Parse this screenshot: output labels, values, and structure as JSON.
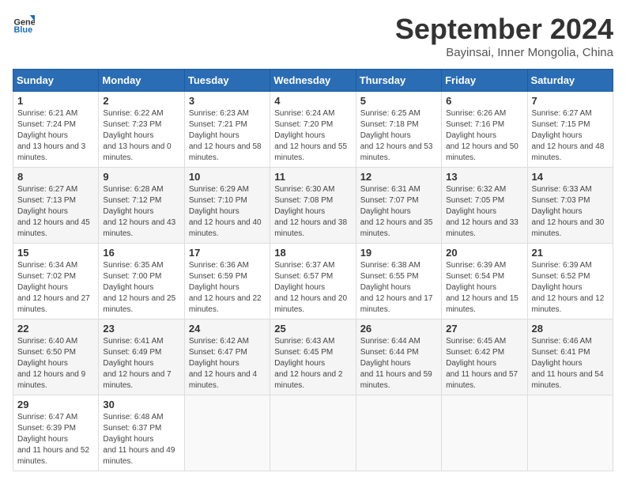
{
  "header": {
    "logo_general": "General",
    "logo_blue": "Blue",
    "month_title": "September 2024",
    "location": "Bayinsai, Inner Mongolia, China"
  },
  "days_of_week": [
    "Sunday",
    "Monday",
    "Tuesday",
    "Wednesday",
    "Thursday",
    "Friday",
    "Saturday"
  ],
  "weeks": [
    [
      {
        "day": "1",
        "sunrise": "6:21 AM",
        "sunset": "7:24 PM",
        "daylight": "13 hours and 3 minutes."
      },
      {
        "day": "2",
        "sunrise": "6:22 AM",
        "sunset": "7:23 PM",
        "daylight": "13 hours and 0 minutes."
      },
      {
        "day": "3",
        "sunrise": "6:23 AM",
        "sunset": "7:21 PM",
        "daylight": "12 hours and 58 minutes."
      },
      {
        "day": "4",
        "sunrise": "6:24 AM",
        "sunset": "7:20 PM",
        "daylight": "12 hours and 55 minutes."
      },
      {
        "day": "5",
        "sunrise": "6:25 AM",
        "sunset": "7:18 PM",
        "daylight": "12 hours and 53 minutes."
      },
      {
        "day": "6",
        "sunrise": "6:26 AM",
        "sunset": "7:16 PM",
        "daylight": "12 hours and 50 minutes."
      },
      {
        "day": "7",
        "sunrise": "6:27 AM",
        "sunset": "7:15 PM",
        "daylight": "12 hours and 48 minutes."
      }
    ],
    [
      {
        "day": "8",
        "sunrise": "6:27 AM",
        "sunset": "7:13 PM",
        "daylight": "12 hours and 45 minutes."
      },
      {
        "day": "9",
        "sunrise": "6:28 AM",
        "sunset": "7:12 PM",
        "daylight": "12 hours and 43 minutes."
      },
      {
        "day": "10",
        "sunrise": "6:29 AM",
        "sunset": "7:10 PM",
        "daylight": "12 hours and 40 minutes."
      },
      {
        "day": "11",
        "sunrise": "6:30 AM",
        "sunset": "7:08 PM",
        "daylight": "12 hours and 38 minutes."
      },
      {
        "day": "12",
        "sunrise": "6:31 AM",
        "sunset": "7:07 PM",
        "daylight": "12 hours and 35 minutes."
      },
      {
        "day": "13",
        "sunrise": "6:32 AM",
        "sunset": "7:05 PM",
        "daylight": "12 hours and 33 minutes."
      },
      {
        "day": "14",
        "sunrise": "6:33 AM",
        "sunset": "7:03 PM",
        "daylight": "12 hours and 30 minutes."
      }
    ],
    [
      {
        "day": "15",
        "sunrise": "6:34 AM",
        "sunset": "7:02 PM",
        "daylight": "12 hours and 27 minutes."
      },
      {
        "day": "16",
        "sunrise": "6:35 AM",
        "sunset": "7:00 PM",
        "daylight": "12 hours and 25 minutes."
      },
      {
        "day": "17",
        "sunrise": "6:36 AM",
        "sunset": "6:59 PM",
        "daylight": "12 hours and 22 minutes."
      },
      {
        "day": "18",
        "sunrise": "6:37 AM",
        "sunset": "6:57 PM",
        "daylight": "12 hours and 20 minutes."
      },
      {
        "day": "19",
        "sunrise": "6:38 AM",
        "sunset": "6:55 PM",
        "daylight": "12 hours and 17 minutes."
      },
      {
        "day": "20",
        "sunrise": "6:39 AM",
        "sunset": "6:54 PM",
        "daylight": "12 hours and 15 minutes."
      },
      {
        "day": "21",
        "sunrise": "6:39 AM",
        "sunset": "6:52 PM",
        "daylight": "12 hours and 12 minutes."
      }
    ],
    [
      {
        "day": "22",
        "sunrise": "6:40 AM",
        "sunset": "6:50 PM",
        "daylight": "12 hours and 9 minutes."
      },
      {
        "day": "23",
        "sunrise": "6:41 AM",
        "sunset": "6:49 PM",
        "daylight": "12 hours and 7 minutes."
      },
      {
        "day": "24",
        "sunrise": "6:42 AM",
        "sunset": "6:47 PM",
        "daylight": "12 hours and 4 minutes."
      },
      {
        "day": "25",
        "sunrise": "6:43 AM",
        "sunset": "6:45 PM",
        "daylight": "12 hours and 2 minutes."
      },
      {
        "day": "26",
        "sunrise": "6:44 AM",
        "sunset": "6:44 PM",
        "daylight": "11 hours and 59 minutes."
      },
      {
        "day": "27",
        "sunrise": "6:45 AM",
        "sunset": "6:42 PM",
        "daylight": "11 hours and 57 minutes."
      },
      {
        "day": "28",
        "sunrise": "6:46 AM",
        "sunset": "6:41 PM",
        "daylight": "11 hours and 54 minutes."
      }
    ],
    [
      {
        "day": "29",
        "sunrise": "6:47 AM",
        "sunset": "6:39 PM",
        "daylight": "11 hours and 52 minutes."
      },
      {
        "day": "30",
        "sunrise": "6:48 AM",
        "sunset": "6:37 PM",
        "daylight": "11 hours and 49 minutes."
      },
      null,
      null,
      null,
      null,
      null
    ]
  ]
}
